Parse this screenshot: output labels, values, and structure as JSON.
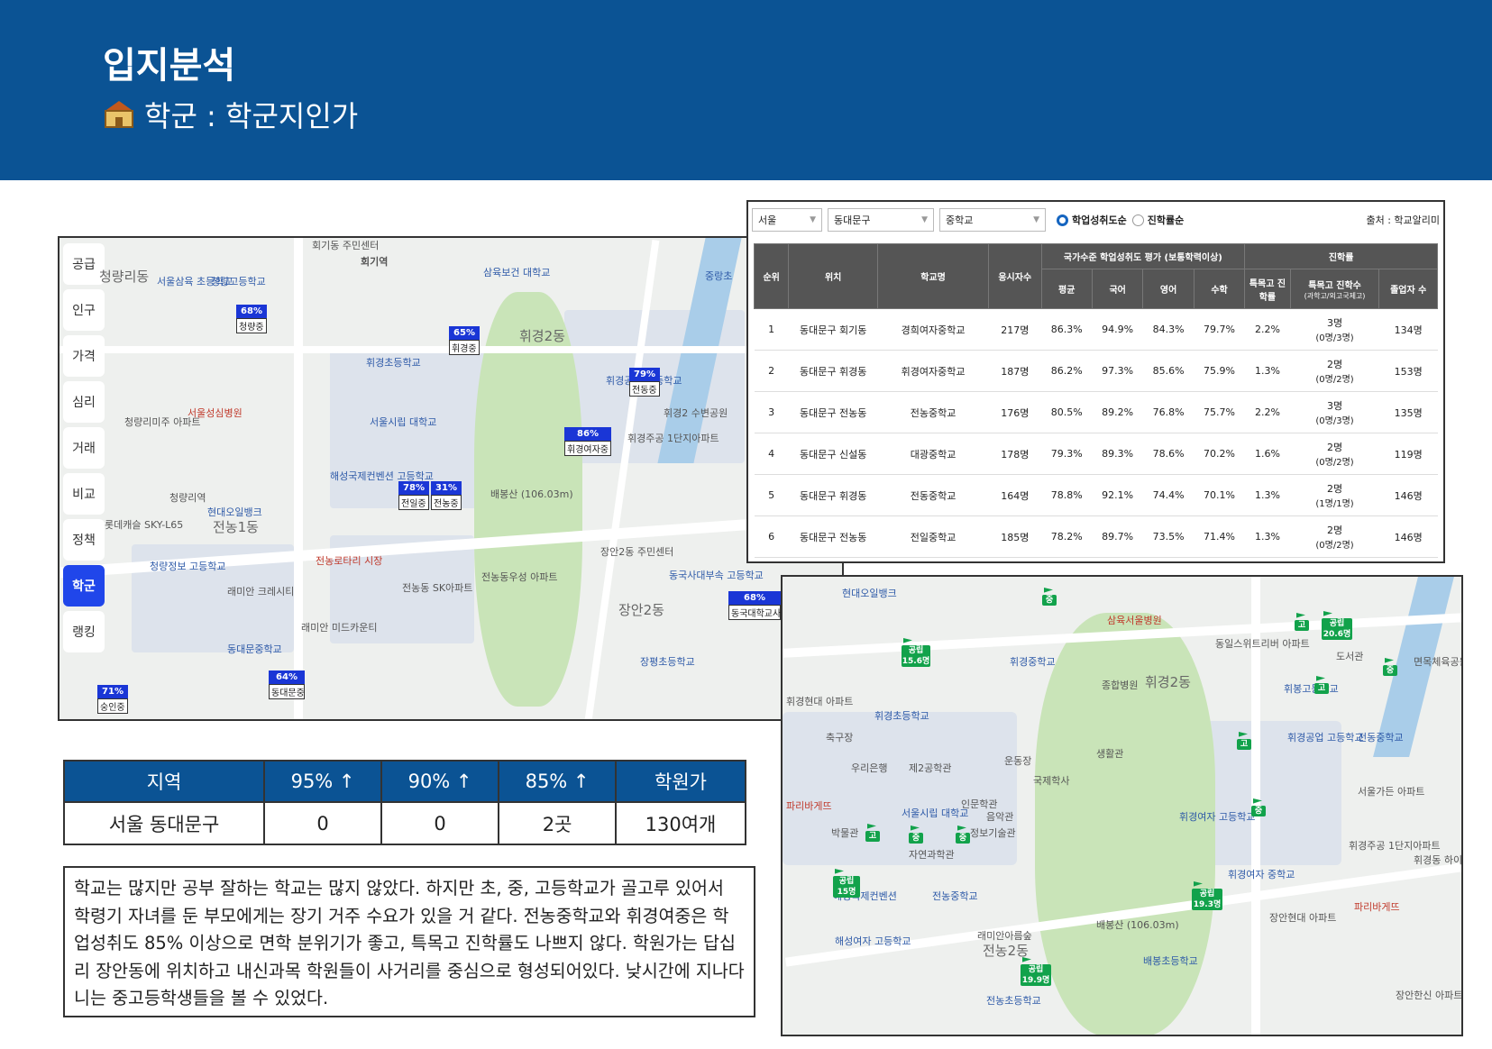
{
  "header": {
    "title": "입지분석",
    "subtitle": "학군 : 학군지인가",
    "subtitle_icon": "school-icon"
  },
  "map_left": {
    "sidebar": [
      "공급",
      "인구",
      "가격",
      "심리",
      "거래",
      "비교",
      "정책",
      "학군",
      "랭킹"
    ],
    "active_item": "학군",
    "labels": {
      "l1": "청량리동",
      "l2": "서울삼육 초등학교",
      "l3": "청량고등학교",
      "l4": "회기역",
      "l5": "삼육보건 대학교",
      "l6": "휘경2동",
      "l7": "휘경초등학교",
      "l8": "서울성심병원",
      "l9": "청량리미주 아파트",
      "l10": "서울시립 대학교",
      "l11": "휘경공업 고등학교",
      "l12": "해성국제컨벤션 고등학교",
      "l13": "배봉산 (106.03m)",
      "l14": "휘경주공 1단지아파트",
      "l15": "청량리역",
      "l16": "현대오일뱅크",
      "l17": "전농1동",
      "l18": "롯데캐슬 SKY-L65",
      "l19": "청량정보 고등학교",
      "l20": "전농로타리 시장",
      "l21": "전농동 SK아파트",
      "l22": "전농동우성 아파트",
      "l23": "장안2동 주민센터",
      "l24": "장안2동",
      "l25": "래미안 크레시티",
      "l26": "래미안 미드카운티",
      "l27": "동대문중학교",
      "l28": "장평초등학교",
      "l29": "동국사대부속 고등학교",
      "l30": "휘경2 수변공원",
      "l31": "회기동 주민센터",
      "l32": "중랑초"
    },
    "flags": [
      {
        "pct": "68%",
        "name": "청량중"
      },
      {
        "pct": "65%",
        "name": "휘경중"
      },
      {
        "pct": "79%",
        "name": "전동중"
      },
      {
        "pct": "86%",
        "name": "휘경여자중"
      },
      {
        "pct": "78%",
        "name": "전일중"
      },
      {
        "pct": "31%",
        "name": "전농중"
      },
      {
        "pct": "68%",
        "name": "동국대학교사"
      },
      {
        "pct": "64%",
        "name": "동대문중"
      },
      {
        "pct": "71%",
        "name": "숭인중"
      }
    ]
  },
  "ranking": {
    "filters": {
      "city": "서울",
      "district": "동대문구",
      "level": "중학교"
    },
    "radio": {
      "opt1": "학업성취도순",
      "opt2": "진학률순",
      "selected": "학업성취도순"
    },
    "source": "출처 : 학교알리미",
    "headers": {
      "rank": "순위",
      "loc": "위치",
      "school": "학교명",
      "takers": "응시자수",
      "achievement_group": "국가수준 학업성취도 평가 (보통학력이상)",
      "avg": "평균",
      "kor": "국어",
      "eng": "영어",
      "math": "수학",
      "advance_group": "진학률",
      "special_rate": "특목고 진학률",
      "special_count": "특목고 진학수",
      "special_count_sub": "(과학고/외고국제고)",
      "grads": "졸업자 수"
    },
    "rows": [
      {
        "rank": "1",
        "loc": "동대문구 회기동",
        "school": "경희여자중학교",
        "takers": "217명",
        "avg": "86.3%",
        "kor": "94.9%",
        "eng": "84.3%",
        "math": "79.7%",
        "rate": "2.2%",
        "cnt": "3명",
        "cnt_sub": "(0명/3명)",
        "grads": "134명"
      },
      {
        "rank": "2",
        "loc": "동대문구 휘경동",
        "school": "휘경여자중학교",
        "takers": "187명",
        "avg": "86.2%",
        "kor": "97.3%",
        "eng": "85.6%",
        "math": "75.9%",
        "rate": "1.3%",
        "cnt": "2명",
        "cnt_sub": "(0명/2명)",
        "grads": "153명"
      },
      {
        "rank": "3",
        "loc": "동대문구 전농동",
        "school": "전농중학교",
        "takers": "176명",
        "avg": "80.5%",
        "kor": "89.2%",
        "eng": "76.8%",
        "math": "75.7%",
        "rate": "2.2%",
        "cnt": "3명",
        "cnt_sub": "(0명/3명)",
        "grads": "135명"
      },
      {
        "rank": "4",
        "loc": "동대문구 신설동",
        "school": "대광중학교",
        "takers": "178명",
        "avg": "79.3%",
        "kor": "89.3%",
        "eng": "78.6%",
        "math": "70.2%",
        "rate": "1.6%",
        "cnt": "2명",
        "cnt_sub": "(0명/2명)",
        "grads": "119명"
      },
      {
        "rank": "5",
        "loc": "동대문구 휘경동",
        "school": "전동중학교",
        "takers": "164명",
        "avg": "78.8%",
        "kor": "92.1%",
        "eng": "74.4%",
        "math": "70.1%",
        "rate": "1.3%",
        "cnt": "2명",
        "cnt_sub": "(1명/1명)",
        "grads": "146명"
      },
      {
        "rank": "6",
        "loc": "동대문구 전농동",
        "school": "전일중학교",
        "takers": "185명",
        "avg": "78.2%",
        "kor": "89.7%",
        "eng": "73.5%",
        "math": "71.4%",
        "rate": "1.3%",
        "cnt": "2명",
        "cnt_sub": "(0명/2명)",
        "grads": "146명"
      }
    ]
  },
  "map_right": {
    "labels": {
      "r1": "현대오일뱅크",
      "r2": "삼육서울병원",
      "r3": "동일스위트리버 아파트",
      "r4": "도서관",
      "r5": "면목체육공원",
      "r6": "휘경중학교",
      "r7": "종합병원",
      "r8": "휘경2동",
      "r9": "휘봉고등학교",
      "r10": "휘경현대 아파트",
      "r11": "휘경초등학교",
      "r12": "축구장",
      "r13": "휘경공업 고등학교",
      "r14": "전동중학교",
      "r15": "우리은행",
      "r16": "제2공학관",
      "r17": "운동장",
      "r18": "생활관",
      "r19": "국제학사",
      "r20": "서울가든 아파트",
      "r21": "파리바게뜨",
      "r22": "인문학관",
      "r23": "음악관",
      "r24": "서울시립 대학교",
      "r25": "박물관",
      "r26": "정보기술관",
      "r27": "휘경여자 고등학교",
      "r28": "휘경주공 1단지아파트",
      "r29": "자연과학관",
      "r30": "휘경여자 중학교",
      "r31": "휘경동 하이빌아파트",
      "r32": "해성국제컨벤션",
      "r33": "전농중학교",
      "r34": "장안현대 아파트",
      "r35": "파리바게뜨",
      "r36": "해성여자 고등학교",
      "r37": "래미안아름숲",
      "r38": "전농2동",
      "r39": "배봉산 (106.03m)",
      "r40": "배봉초등학교",
      "r41": "전농초등학교",
      "r42": "장안한신 아파트"
    },
    "flags": [
      {
        "t": "공립",
        "v": "15.6명"
      },
      {
        "t": "공립",
        "v": "20.6명"
      },
      {
        "t": "공립",
        "v": "15명"
      },
      {
        "t": "공립",
        "v": "19.3명"
      },
      {
        "t": "공립",
        "v": "19.9명"
      },
      {
        "t": "중"
      },
      {
        "t": "고"
      },
      {
        "t": "중"
      },
      {
        "t": "고"
      },
      {
        "t": "고"
      },
      {
        "t": "중"
      },
      {
        "t": "고"
      },
      {
        "t": "중"
      },
      {
        "t": "중"
      }
    ]
  },
  "summary": {
    "headers": [
      "지역",
      "95% ↑",
      "90% ↑",
      "85% ↑",
      "학원가"
    ],
    "row": [
      "서울 동대문구",
      "0",
      "0",
      "2곳",
      "130여개"
    ]
  },
  "comment": "학교는 많지만 공부 잘하는 학교는 많지 않았다. 하지만 초, 중, 고등학교가 골고루 있어서 학령기 자녀를 둔 부모에게는 장기 거주 수요가 있을 거 같다. 전농중학교와 휘경여중은 학업성취도 85% 이상으로 면학 분위기가 좋고, 특목고 진학률도 나쁘지 않다. 학원가는 답십리 장안동에 위치하고 내신과목 학원들이 사거리를 중심으로 형성되어있다. 낮시간에 지나다니는 중고등학생들을 볼 수 있었다.",
  "colors": {
    "header_bg": "#0b5394",
    "flag_blue": "#1a36d6",
    "flag_green": "#12a24b",
    "active_tab": "#2046ea"
  }
}
